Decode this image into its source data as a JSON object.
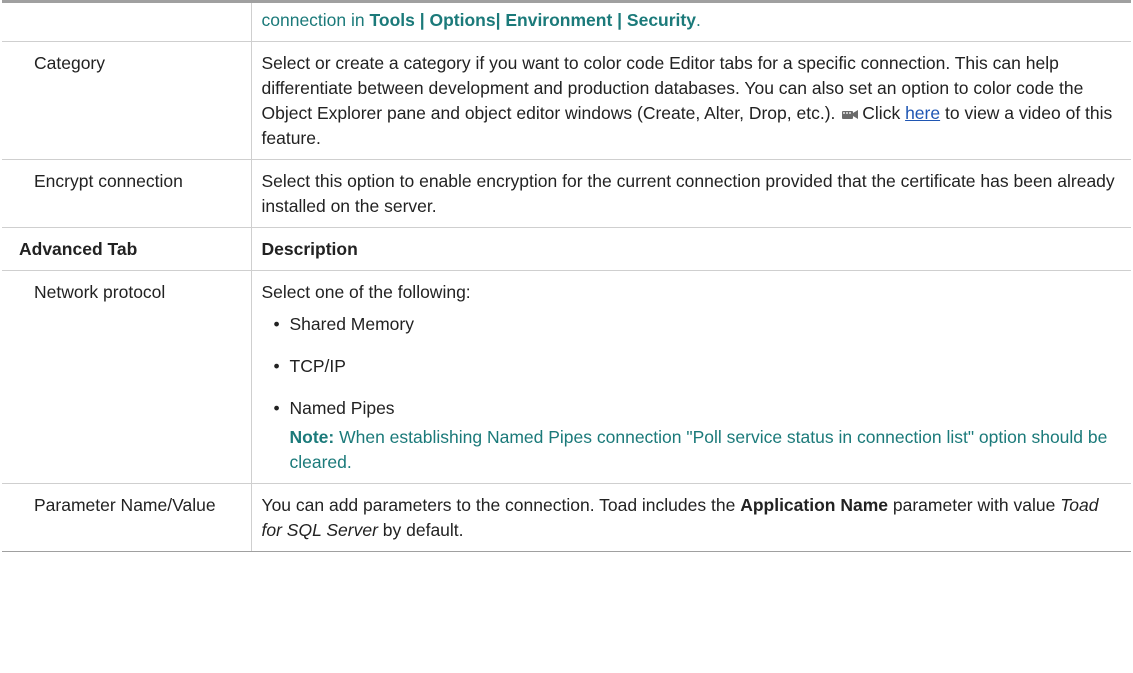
{
  "rows": [
    {
      "label": "",
      "desc_prefix": "connection in ",
      "desc_bold": "Tools | Options| Environment | Security",
      "desc_suffix": "."
    },
    {
      "label": "Category",
      "desc": "Select or create a category if you want to color code Editor tabs for a specific connection. This can help differentiate between development and production databases. You can also set an option to color code the Object Explorer pane and object editor windows (Create, Alter, Drop, etc.).",
      "click_text": "Click",
      "link_text": "here",
      "desc_after_link": "to view a video of this feature."
    },
    {
      "label": "Encrypt connection",
      "desc": "Select this option to enable encryption for the current connection provided that the certificate has been already installed on the server."
    }
  ],
  "advanced_header": {
    "label": "Advanced Tab",
    "desc": "Description"
  },
  "network": {
    "label": "Network protocol",
    "intro": "Select one of the following:",
    "options": [
      "Shared Memory",
      "TCP/IP",
      "Named Pipes"
    ],
    "note_label": "Note:",
    "note_text": "When establishing Named Pipes connection \"Poll service status in connection list\" option should be cleared."
  },
  "parameter": {
    "label": "Parameter Name/Value",
    "desc_1": "You can add parameters to the connection. Toad includes the",
    "desc_bold": "Application Name",
    "desc_2": "parameter with value",
    "desc_italic": "Toad for SQL Server",
    "desc_3": "by default."
  },
  "colors": {
    "teal": "#1b7a7a",
    "link": "#1f56b3",
    "border": "#cfcfcf"
  },
  "icons": {
    "video": "video-camera-icon"
  }
}
